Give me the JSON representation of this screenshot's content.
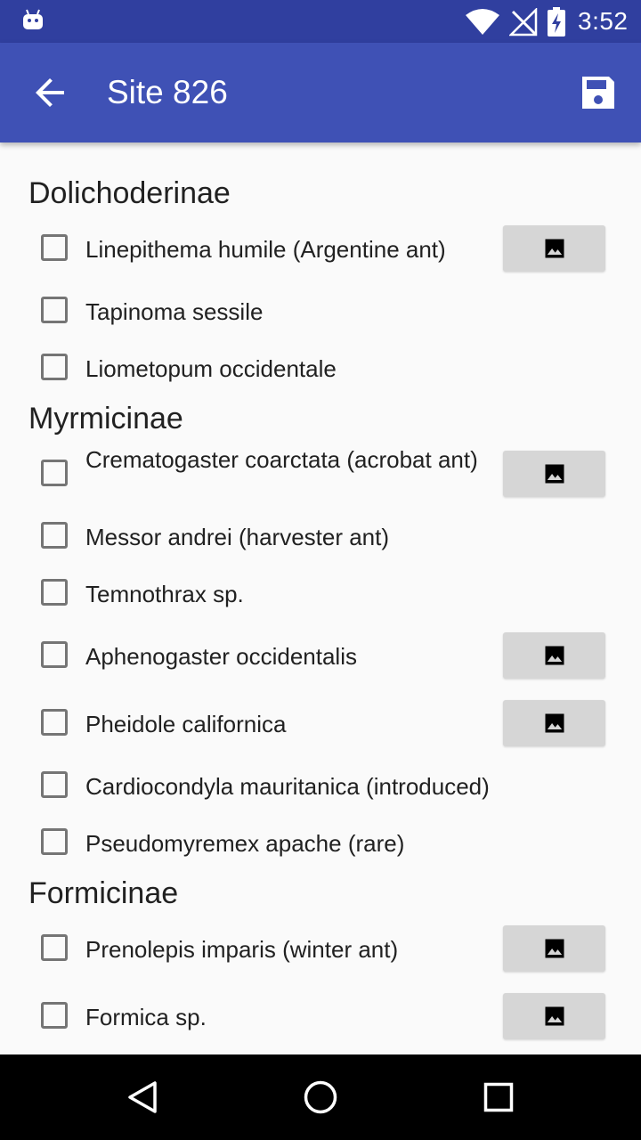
{
  "status_bar": {
    "time": "3:52",
    "icons": [
      "android-debug-icon",
      "wifi-icon",
      "no-signal-icon",
      "battery-charging-icon"
    ]
  },
  "app_bar": {
    "title": "Site 826",
    "back_icon": "arrow-back-icon",
    "save_icon": "save-icon"
  },
  "colors": {
    "status_bar": "#303f9f",
    "app_bar": "#3f51b5",
    "background": "#fafafa",
    "photo_button": "#d6d6d6",
    "nav_bar": "#000000"
  },
  "sections": [
    {
      "title": "Dolichoderinae",
      "items": [
        {
          "label": "Linepithema humile (Argentine ant)",
          "checked": false,
          "has_photo": true
        },
        {
          "label": "Tapinoma sessile",
          "checked": false,
          "has_photo": false
        },
        {
          "label": "Liometopum occidentale",
          "checked": false,
          "has_photo": false
        }
      ]
    },
    {
      "title": "Myrmicinae",
      "items": [
        {
          "label": "Crematogaster coarctata (acrobat ant)",
          "checked": false,
          "has_photo": true
        },
        {
          "label": "Messor andrei (harvester ant)",
          "checked": false,
          "has_photo": false
        },
        {
          "label": "Temnothrax sp.",
          "checked": false,
          "has_photo": false
        },
        {
          "label": "Aphenogaster occidentalis",
          "checked": false,
          "has_photo": true
        },
        {
          "label": "Pheidole californica",
          "checked": false,
          "has_photo": true
        },
        {
          "label": "Cardiocondyla mauritanica (introduced)",
          "checked": false,
          "has_photo": false
        },
        {
          "label": "Pseudomyremex apache (rare)",
          "checked": false,
          "has_photo": false
        }
      ]
    },
    {
      "title": "Formicinae",
      "items": [
        {
          "label": "Prenolepis imparis (winter ant)",
          "checked": false,
          "has_photo": true
        },
        {
          "label": "Formica sp.",
          "checked": false,
          "has_photo": true
        }
      ]
    }
  ],
  "nav_bar": {
    "icons": [
      "back-triangle-icon",
      "home-circle-icon",
      "recents-square-icon"
    ]
  }
}
